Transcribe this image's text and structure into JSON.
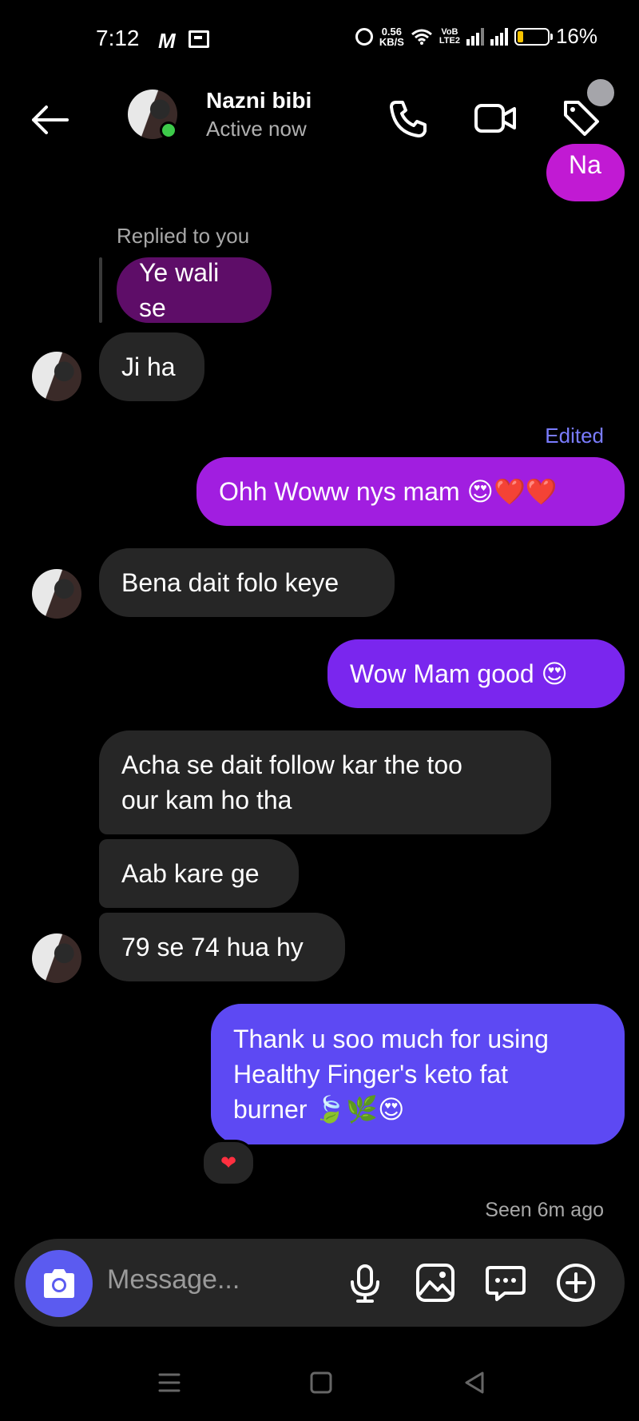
{
  "status_bar": {
    "time": "7:12",
    "carrier_icon": "M",
    "net_speed_value": "0.56",
    "net_speed_unit": "KB/S",
    "volte_top": "VoB",
    "volte_bottom": "LTE2",
    "battery": "16%",
    "battery_color": "#f7c400"
  },
  "header": {
    "contact_name": "Nazni bibi",
    "presence": "Active now",
    "online_color": "#3dcb4a"
  },
  "messages": {
    "partial_out": "Na",
    "replied_label": "Replied to you",
    "reply_quote": "Ye wali se",
    "m1": "Ji ha",
    "edited_label": "Edited",
    "m2": "Ohh Woww nys mam 😍❤️❤️",
    "m3": "Bena dait folo keye",
    "m4": "Wow Mam good 😍",
    "m5_line1": "Acha se dait follow kar the too",
    "m5_line2": "our kam ho tha",
    "m6": "Aab kare ge",
    "m7": "79 se 74 hua hy",
    "m8_line1": "Thank u soo much for using",
    "m8_line2": "Healthy Finger's keto fat",
    "m8_line3": "burner 🍃🌿😍",
    "reaction": "❤",
    "seen": "Seen 6m ago"
  },
  "composer": {
    "placeholder": "Message..."
  },
  "colors": {
    "incoming_bubble": "#262626",
    "accent": "#5b5bf0",
    "outgoing_gradient_top": "#b51ed6",
    "outgoing_gradient_bottom": "#5b4cf5"
  }
}
